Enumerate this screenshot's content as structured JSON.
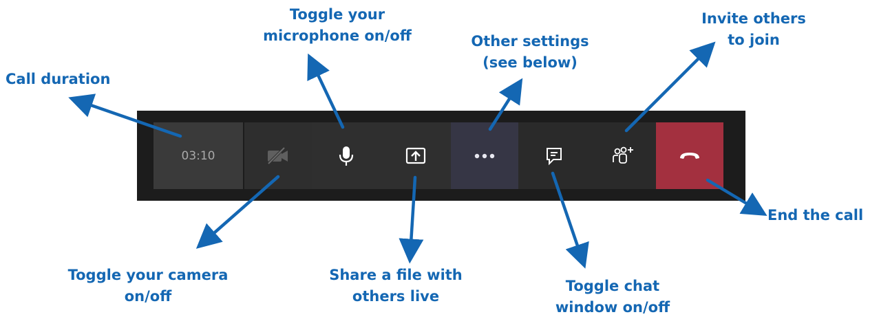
{
  "call_bar": {
    "duration": "03:10",
    "buttons": [
      {
        "name": "camera-toggle",
        "icon": "camera-off-icon"
      },
      {
        "name": "microphone-toggle",
        "icon": "microphone-icon"
      },
      {
        "name": "share-tray",
        "icon": "share-screen-icon"
      },
      {
        "name": "more-actions",
        "icon": "ellipsis-icon"
      },
      {
        "name": "chat-toggle",
        "icon": "chat-icon"
      },
      {
        "name": "invite-participants",
        "icon": "add-people-icon"
      },
      {
        "name": "hang-up",
        "icon": "phone-hangup-icon"
      }
    ],
    "colors": {
      "bar_background": "#1c1c1c",
      "more_button_background": "#363645",
      "end_button_background": "#a3303f",
      "annotation_color": "#1467b3"
    }
  },
  "annotations": {
    "call_duration": "Call duration",
    "mic_line1": "Toggle your",
    "mic_line2": "microphone on/off",
    "settings_line1": "Other settings",
    "settings_line2": "(see below)",
    "invite_line1": "Invite others",
    "invite_line2": "to join",
    "camera_line1": "Toggle your camera",
    "camera_line2": "on/off",
    "share_line1": "Share a file with",
    "share_line2": "others live",
    "chat_line1": "Toggle chat",
    "chat_line2": "window on/off",
    "end_call": "End the call"
  }
}
